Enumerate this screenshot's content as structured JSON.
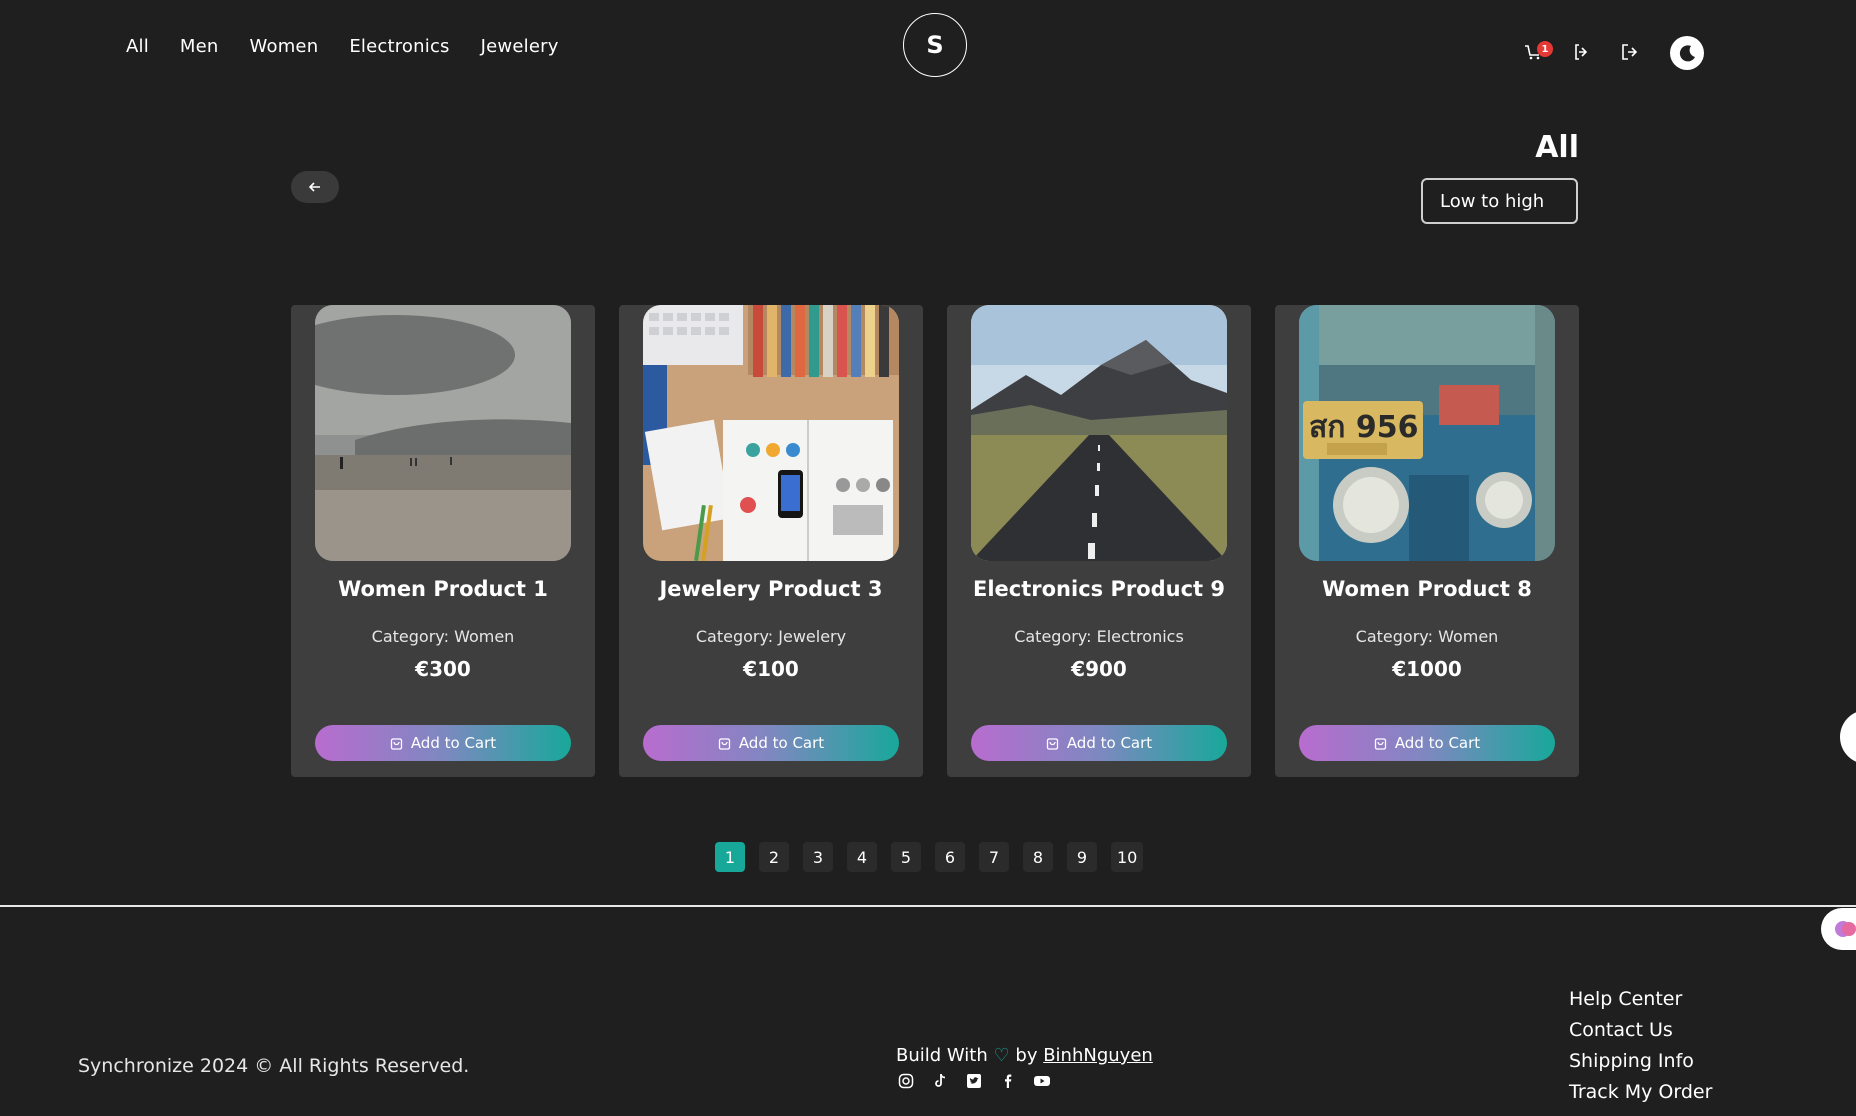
{
  "nav": {
    "links": [
      "All",
      "Men",
      "Women",
      "Electronics",
      "Jewelery"
    ],
    "logo_letter": "S",
    "cart_count": "1"
  },
  "section": {
    "title": "All",
    "sort_value": "Low to high"
  },
  "products": [
    {
      "title": "Women Product 1",
      "category": "Category: Women",
      "price": "€300",
      "button": "Add to Cart",
      "image": "beach-landscape"
    },
    {
      "title": "Jewelery Product 3",
      "category": "Category: Jewelery",
      "price": "€100",
      "button": "Add to Cart",
      "image": "desk-workspace"
    },
    {
      "title": "Electronics Product 9",
      "category": "Category: Electronics",
      "price": "€900",
      "button": "Add to Cart",
      "image": "mountain-road"
    },
    {
      "title": "Women Product 8",
      "category": "Category: Women",
      "price": "€1000",
      "button": "Add to Cart",
      "image": "tuk-tuk-license-plate"
    }
  ],
  "pagination": {
    "pages": [
      "1",
      "2",
      "3",
      "4",
      "5",
      "6",
      "7",
      "8",
      "9",
      "10"
    ],
    "current": "1"
  },
  "footer": {
    "copyright": "Synchronize 2024 © All Rights Reserved.",
    "build_prefix": "Build With",
    "heart": "♡",
    "by": "by",
    "author": "BinhNguyen",
    "plate_text": "สก 956",
    "socials": [
      "instagram-icon",
      "tiktok-icon",
      "twitter-icon",
      "facebook-icon",
      "youtube-icon"
    ],
    "links": [
      "Help Center",
      "Contact Us",
      "Shipping Info",
      "Track My Order"
    ]
  },
  "colors": {
    "accent": "#18a89a",
    "gradient_start": "#b86ccf",
    "card_bg": "#3e3e3e",
    "page_bg": "#1f1f1f"
  }
}
